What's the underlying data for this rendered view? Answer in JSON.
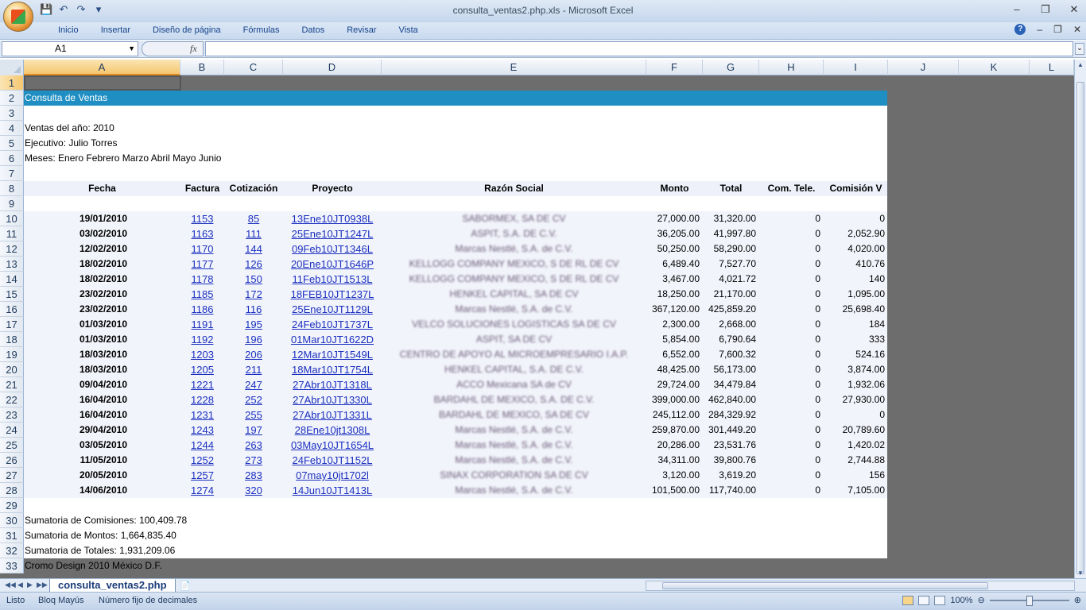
{
  "window": {
    "title": "consulta_ventas2.php.xls - Microsoft Excel"
  },
  "ribbon": {
    "tabs": [
      "Inicio",
      "Insertar",
      "Diseño de página",
      "Fórmulas",
      "Datos",
      "Revisar",
      "Vista"
    ]
  },
  "formula_bar": {
    "name_box": "A1",
    "fx_label": "fx",
    "formula": ""
  },
  "columns": [
    "A",
    "B",
    "C",
    "D",
    "E",
    "F",
    "G",
    "H",
    "I",
    "J",
    "K",
    "L"
  ],
  "row_numbers": [
    "1",
    "2",
    "3",
    "4",
    "5",
    "6",
    "7",
    "8",
    "9",
    "10",
    "11",
    "12",
    "13",
    "14",
    "15",
    "16",
    "17",
    "18",
    "19",
    "20",
    "21",
    "22",
    "23",
    "24",
    "25",
    "26",
    "27",
    "28",
    "29",
    "30",
    "31",
    "32",
    "33"
  ],
  "sheet": {
    "banner": "Consulta de Ventas",
    "info": [
      "Ventas del año: 2010",
      "Ejecutivo: Julio Torres",
      "Meses: Enero Febrero Marzo Abril Mayo Junio"
    ],
    "headers": [
      "Fecha",
      "Factura",
      "Cotización",
      "Proyecto",
      "Razón Social",
      "Monto",
      "Total",
      "Com. Tele.",
      "Comisión V"
    ],
    "rows": [
      {
        "fecha": "19/01/2010",
        "factura": "1153",
        "cot": "85",
        "proyecto": "13Ene10JT0938L",
        "razon": "SABORMEX, SA DE CV",
        "monto": "27,000.00",
        "total": "31,320.00",
        "tele": "0",
        "comision": "0"
      },
      {
        "fecha": "03/02/2010",
        "factura": "1163",
        "cot": "111",
        "proyecto": "25Ene10JT1247L",
        "razon": "ASPIT, S.A. DE C.V.",
        "monto": "36,205.00",
        "total": "41,997.80",
        "tele": "0",
        "comision": "2,052.90"
      },
      {
        "fecha": "12/02/2010",
        "factura": "1170",
        "cot": "144",
        "proyecto": "09Feb10JT1346L",
        "razon": "Marcas Nestlé, S.A. de C.V.",
        "monto": "50,250.00",
        "total": "58,290.00",
        "tele": "0",
        "comision": "4,020.00"
      },
      {
        "fecha": "18/02/2010",
        "factura": "1177",
        "cot": "126",
        "proyecto": "20Ene10JT1646P",
        "razon": "KELLOGG COMPANY MEXICO, S DE RL DE CV",
        "monto": "6,489.40",
        "total": "7,527.70",
        "tele": "0",
        "comision": "410.76"
      },
      {
        "fecha": "18/02/2010",
        "factura": "1178",
        "cot": "150",
        "proyecto": "11Feb10JT1513L",
        "razon": "KELLOGG COMPANY MEXICO, S DE RL DE CV",
        "monto": "3,467.00",
        "total": "4,021.72",
        "tele": "0",
        "comision": "140"
      },
      {
        "fecha": "23/02/2010",
        "factura": "1185",
        "cot": "172",
        "proyecto": "18FEB10JT1237L",
        "razon": "HENKEL CAPITAL, SA DE CV",
        "monto": "18,250.00",
        "total": "21,170.00",
        "tele": "0",
        "comision": "1,095.00"
      },
      {
        "fecha": "23/02/2010",
        "factura": "1186",
        "cot": "116",
        "proyecto": "25Ene10JT1129L",
        "razon": "Marcas Nestlé, S.A. de C.V.",
        "monto": "367,120.00",
        "total": "425,859.20",
        "tele": "0",
        "comision": "25,698.40"
      },
      {
        "fecha": "01/03/2010",
        "factura": "1191",
        "cot": "195",
        "proyecto": "24Feb10JT1737L",
        "razon": "VELCO SOLUCIONES LOGISTICAS SA DE CV",
        "monto": "2,300.00",
        "total": "2,668.00",
        "tele": "0",
        "comision": "184"
      },
      {
        "fecha": "01/03/2010",
        "factura": "1192",
        "cot": "196",
        "proyecto": "01Mar10JT1622D",
        "razon": "ASPIT, SA DE CV",
        "monto": "5,854.00",
        "total": "6,790.64",
        "tele": "0",
        "comision": "333"
      },
      {
        "fecha": "18/03/2010",
        "factura": "1203",
        "cot": "206",
        "proyecto": "12Mar10JT1549L",
        "razon": "CENTRO DE APOYO AL MICROEMPRESARIO I.A.P.",
        "monto": "6,552.00",
        "total": "7,600.32",
        "tele": "0",
        "comision": "524.16"
      },
      {
        "fecha": "18/03/2010",
        "factura": "1205",
        "cot": "211",
        "proyecto": "18Mar10JT1754L",
        "razon": "HENKEL CAPITAL, S.A. DE C.V.",
        "monto": "48,425.00",
        "total": "56,173.00",
        "tele": "0",
        "comision": "3,874.00"
      },
      {
        "fecha": "09/04/2010",
        "factura": "1221",
        "cot": "247",
        "proyecto": "27Abr10JT1318L",
        "razon": "ACCO Mexicana SA de CV",
        "monto": "29,724.00",
        "total": "34,479.84",
        "tele": "0",
        "comision": "1,932.06"
      },
      {
        "fecha": "16/04/2010",
        "factura": "1228",
        "cot": "252",
        "proyecto": "27Abr10JT1330L",
        "razon": "BARDAHL DE MEXICO, S.A. DE C.V.",
        "monto": "399,000.00",
        "total": "462,840.00",
        "tele": "0",
        "comision": "27,930.00"
      },
      {
        "fecha": "16/04/2010",
        "factura": "1231",
        "cot": "255",
        "proyecto": "27Abr10JT1331L",
        "razon": "BARDAHL DE MEXICO, SA DE CV",
        "monto": "245,112.00",
        "total": "284,329.92",
        "tele": "0",
        "comision": "0"
      },
      {
        "fecha": "29/04/2010",
        "factura": "1243",
        "cot": "197",
        "proyecto": "28Ene10jt1308L",
        "razon": "Marcas Nestlé, S.A. de C.V.",
        "monto": "259,870.00",
        "total": "301,449.20",
        "tele": "0",
        "comision": "20,789.60"
      },
      {
        "fecha": "03/05/2010",
        "factura": "1244",
        "cot": "263",
        "proyecto": "03May10JT1654L",
        "razon": "Marcas Nestlé, S.A. de C.V.",
        "monto": "20,286.00",
        "total": "23,531.76",
        "tele": "0",
        "comision": "1,420.02"
      },
      {
        "fecha": "11/05/2010",
        "factura": "1252",
        "cot": "273",
        "proyecto": "24Feb10JT1152L",
        "razon": "Marcas Nestlé, S.A. de C.V.",
        "monto": "34,311.00",
        "total": "39,800.76",
        "tele": "0",
        "comision": "2,744.88"
      },
      {
        "fecha": "20/05/2010",
        "factura": "1257",
        "cot": "283",
        "proyecto": "07may10jt1702l",
        "razon": "SINAX CORPORATION SA DE CV",
        "monto": "3,120.00",
        "total": "3,619.20",
        "tele": "0",
        "comision": "156"
      },
      {
        "fecha": "14/06/2010",
        "factura": "1274",
        "cot": "320",
        "proyecto": "14Jun10JT1413L",
        "razon": "Marcas Nestlé, S.A. de C.V.",
        "monto": "101,500.00",
        "total": "117,740.00",
        "tele": "0",
        "comision": "7,105.00"
      }
    ],
    "sums": [
      "Sumatoria de Comisiones: 100,409.78",
      "Sumatoria de Montos: 1,664,835.40",
      "Sumatoria de Totales: 1,931,209.06"
    ],
    "footer": "Cromo Design 2010 México D.F."
  },
  "sheet_tab": "consulta_ventas2.php",
  "status": {
    "ready": "Listo",
    "caps": "Bloq Mayús",
    "fixed": "Número fijo de decimales",
    "zoom": "100%"
  },
  "colors": {
    "banner": "#1f8ec2",
    "footer": "#6d6d6d",
    "link": "#1a2fbf"
  }
}
